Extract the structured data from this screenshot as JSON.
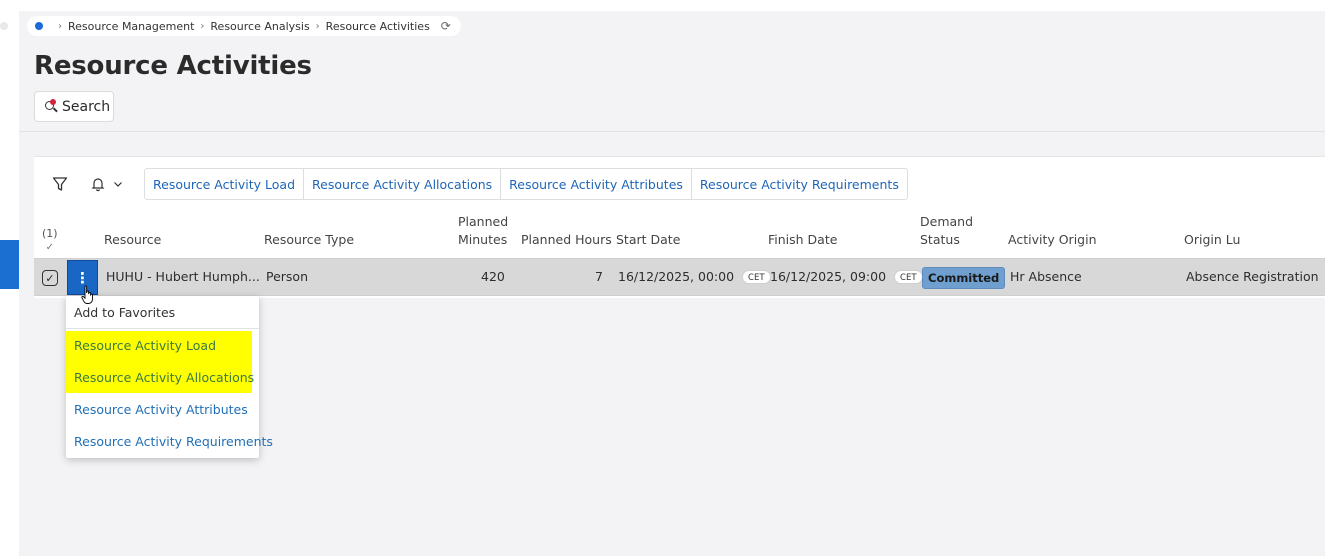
{
  "breadcrumb": {
    "items": [
      "Resource Management",
      "Resource Analysis",
      "Resource Activities"
    ]
  },
  "page": {
    "title": "Resource Activities",
    "search_label": "Search"
  },
  "toolbar": {
    "commands": [
      "Resource Activity Load",
      "Resource Activity Allocations",
      "Resource Activity Attributes",
      "Resource Activity Requirements"
    ]
  },
  "table": {
    "selected_count": "(1)",
    "headers": {
      "resource": "Resource",
      "resource_type": "Resource Type",
      "planned_minutes_1": "Planned",
      "planned_minutes_2": "Minutes",
      "planned_hours": "Planned Hours",
      "start_date": "Start Date",
      "finish_date": "Finish Date",
      "demand_status_1": "Demand",
      "demand_status_2": "Status",
      "activity_origin": "Activity Origin",
      "origin_lu": "Origin Lu"
    },
    "row": {
      "resource": "HUHU - Hubert  Humph...",
      "resource_type": "Person",
      "planned_minutes": "420",
      "planned_hours": "7",
      "start_date": "16/12/2025, 00:00",
      "start_tz": "CET",
      "finish_date": "16/12/2025, 09:00",
      "finish_tz": "CET",
      "demand_status": "Committed",
      "activity_origin": "Hr Absence",
      "origin_lu": "Absence Registration"
    }
  },
  "context_menu": {
    "items": [
      "Add to Favorites",
      "Resource Activity Load",
      "Resource Activity Allocations",
      "Resource Activity Attributes",
      "Resource Activity Requirements"
    ]
  },
  "colors": {
    "accent": "#1a66c4",
    "link": "#1f66b8",
    "highlight": "#ffff00",
    "status_badge": "#6f9fcf"
  }
}
